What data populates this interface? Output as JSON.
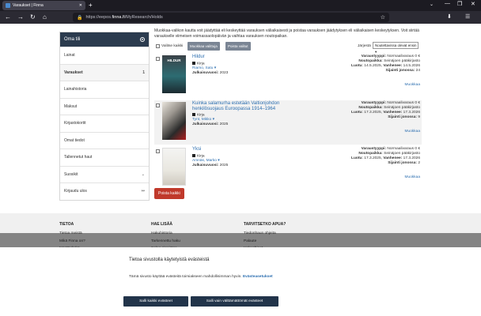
{
  "browser": {
    "tab_title": "Varaukset | Finna",
    "tab_close": "✕",
    "new_tab": "+",
    "tabs_list": "⌄",
    "window_controls": [
      "—",
      "❐",
      "✕"
    ],
    "url": "https://eepos.finna.fi/MyResearch/Holds",
    "url_domain": "finna.fi",
    "url_host_prefix": "eepos.",
    "url_path": "/MyResearch/Holds",
    "nav": [
      "←",
      "→",
      "↻",
      "⌂"
    ],
    "star": "☆",
    "tools": [
      "⬇",
      "☰"
    ]
  },
  "sidebar": {
    "heading": "Oma tili",
    "items": [
      {
        "label": "Lainat",
        "right": ""
      },
      {
        "label": "Varaukset",
        "right": "1"
      },
      {
        "label": "Lainahistoria",
        "right": ""
      },
      {
        "label": "Maksut",
        "right": ""
      },
      {
        "label": "Kirjastokortit",
        "right": ""
      },
      {
        "label": "Omat tiedot",
        "right": ""
      },
      {
        "label": "Tallennetut haut",
        "right": ""
      },
      {
        "label": "Suosikit",
        "right": "⌄"
      },
      {
        "label": "Kirjaudu ulos",
        "right": "↦"
      }
    ]
  },
  "intro": "Muokkaa-valikon kautta voit jäädyttää eli keskeyttää varauksen väliaikaisesti ja poistaa varauksen jäädytyksen eli väliaikaisen keskeytyksen. Voit siirtää varaukselle viimeisen voimassaolopäivän ja vaihtaa varauksen noutopaikan.",
  "toolbar": {
    "select_all": "Valitse kaikki",
    "edit_selected": "Muokkaa valittuja",
    "delete_selected": "Poista valitut",
    "sort_label": "Järjestä",
    "sort_value": "Noutettavissa olevat ensin ▾"
  },
  "results": [
    {
      "title": "Hildur",
      "format": "Kirja",
      "author": "Riamo, Satu ▾",
      "year_label": "Julkaisuvuosi:",
      "year": "2023",
      "type_label": "Varaustyyppi:",
      "type": "Normaalivaraus 0 €",
      "pickup_label": "Noutopaikka:",
      "pickup": "Seinäjoen pääkirjasto",
      "created_label": "Luotu:",
      "created": "14.5.2025",
      "expires_label": "Vanhenee:",
      "expires": "14.5.2026",
      "queue_label": "Sijainti jonossa:",
      "queue": "24",
      "edit": "Muokkaa"
    },
    {
      "title": "Kuinka salamurha estetään Valtionjohdon henkilösuojaus Euroopassa 1914–1964",
      "format": "Kirja",
      "author": "Tynt, Mikko ▾",
      "year_label": "Julkaisuvuosi:",
      "year": "2025",
      "type_label": "Varaustyyppi:",
      "type": "Normaalivaraus 0 €",
      "pickup_label": "Noutopaikka:",
      "pickup": "Seinäjoen pääkirjasto",
      "created_label": "Luotu:",
      "created": "17.3.2025",
      "expires_label": "Vanhenee:",
      "expires": "17.3.2026",
      "queue_label": "Sijainti jonossa:",
      "queue": "9",
      "edit": "Muokkaa"
    },
    {
      "title": "Yksi",
      "format": "Kirja",
      "author": "Amnäs, Marko ▾",
      "year_label": "Julkaisuvuosi:",
      "year": "2025",
      "type_label": "Varaustyyppi:",
      "type": "Normaalivaraus 0 €",
      "pickup_label": "Noutopaikka:",
      "pickup": "Seinäjoen pääkirjasto",
      "created_label": "Luotu:",
      "created": "17.3.2025",
      "expires_label": "Vanhenee:",
      "expires": "17.3.2026",
      "queue_label": "Sijainti jonossa:",
      "queue": "2",
      "edit": "Muokkaa"
    }
  ],
  "cover_text": {
    "hildur": "HILDUR"
  },
  "delete_all": "Poista kaikki",
  "footer": {
    "cols": [
      {
        "heading": "TIETOA",
        "links": [
          "Tietoa meistä",
          "Mikä Finna on?",
          "Käyttöehdot"
        ]
      },
      {
        "heading": "HAE LISÄÄ",
        "links": [
          "Hakuhistoria",
          "Tarkennettu haku",
          "Selaa aineistoa"
        ]
      },
      {
        "heading": "TARVITSETKO APUA?",
        "links": [
          "Tiedonhaun ohjeita",
          "Palaute",
          "Hakuohjeet"
        ]
      }
    ]
  },
  "cookie": {
    "title": "Tietoa sivustolla käytetyistä evästeistä",
    "body": "Tämä sivusto käyttää evästeitä toimiakseen mahdollisimman hyvin.",
    "link": "Evästeasetukset",
    "accept_all": "Salli kaikki evästeet",
    "accept_necessary": "Salli vain välttämättömät evästeet"
  },
  "colors": {
    "accent": "#2b3b4e",
    "link": "#2d6fb0",
    "danger": "#c0392b"
  }
}
